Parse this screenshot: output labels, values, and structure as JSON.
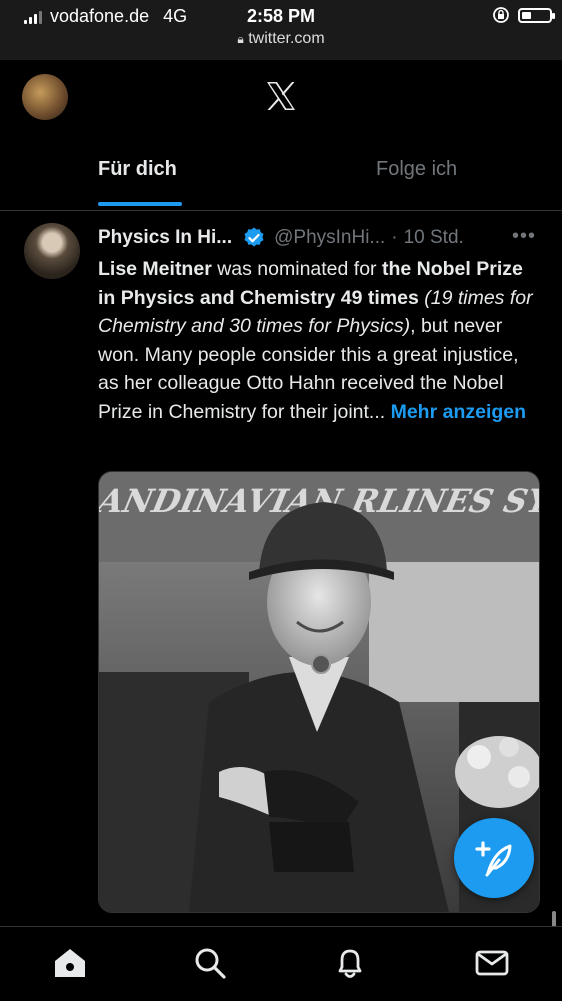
{
  "status_bar": {
    "carrier": "vodafone.de",
    "network": "4G",
    "time": "2:58 PM",
    "url": "twitter.com",
    "battery_level": 0.35
  },
  "header": {
    "tabs": [
      {
        "label": "Für dich",
        "active": true
      },
      {
        "label": "Folge ich",
        "active": false
      }
    ]
  },
  "tweet": {
    "author_name": "Physics In Hi...",
    "handle": "@PhysInHi...",
    "separator": "·",
    "time": "10 Std.",
    "verified": true,
    "text_parts": {
      "p1_bold": "Lise Meitner",
      "p2": " was nominated for ",
      "p3_bold": "the Nobel Prize in Physics and Chemistry 49 times",
      "p4_italic": "(19 times for Chemistry and 30 times for Physics)",
      "p5": ", but never won. Many people consider this a great injustice, as her colleague Otto Hahn received the Nobel Prize in Chemistry for their joint... ",
      "show_more": "Mehr anzeigen"
    },
    "image_sign_text": "ANDINAVIAN RLINES SY..."
  },
  "bottom_nav": [
    "home-icon",
    "search-icon",
    "notifications-icon",
    "messages-icon"
  ],
  "colors": {
    "accent": "#1d9bf0",
    "background": "#000000",
    "secondary_text": "#71767b"
  }
}
